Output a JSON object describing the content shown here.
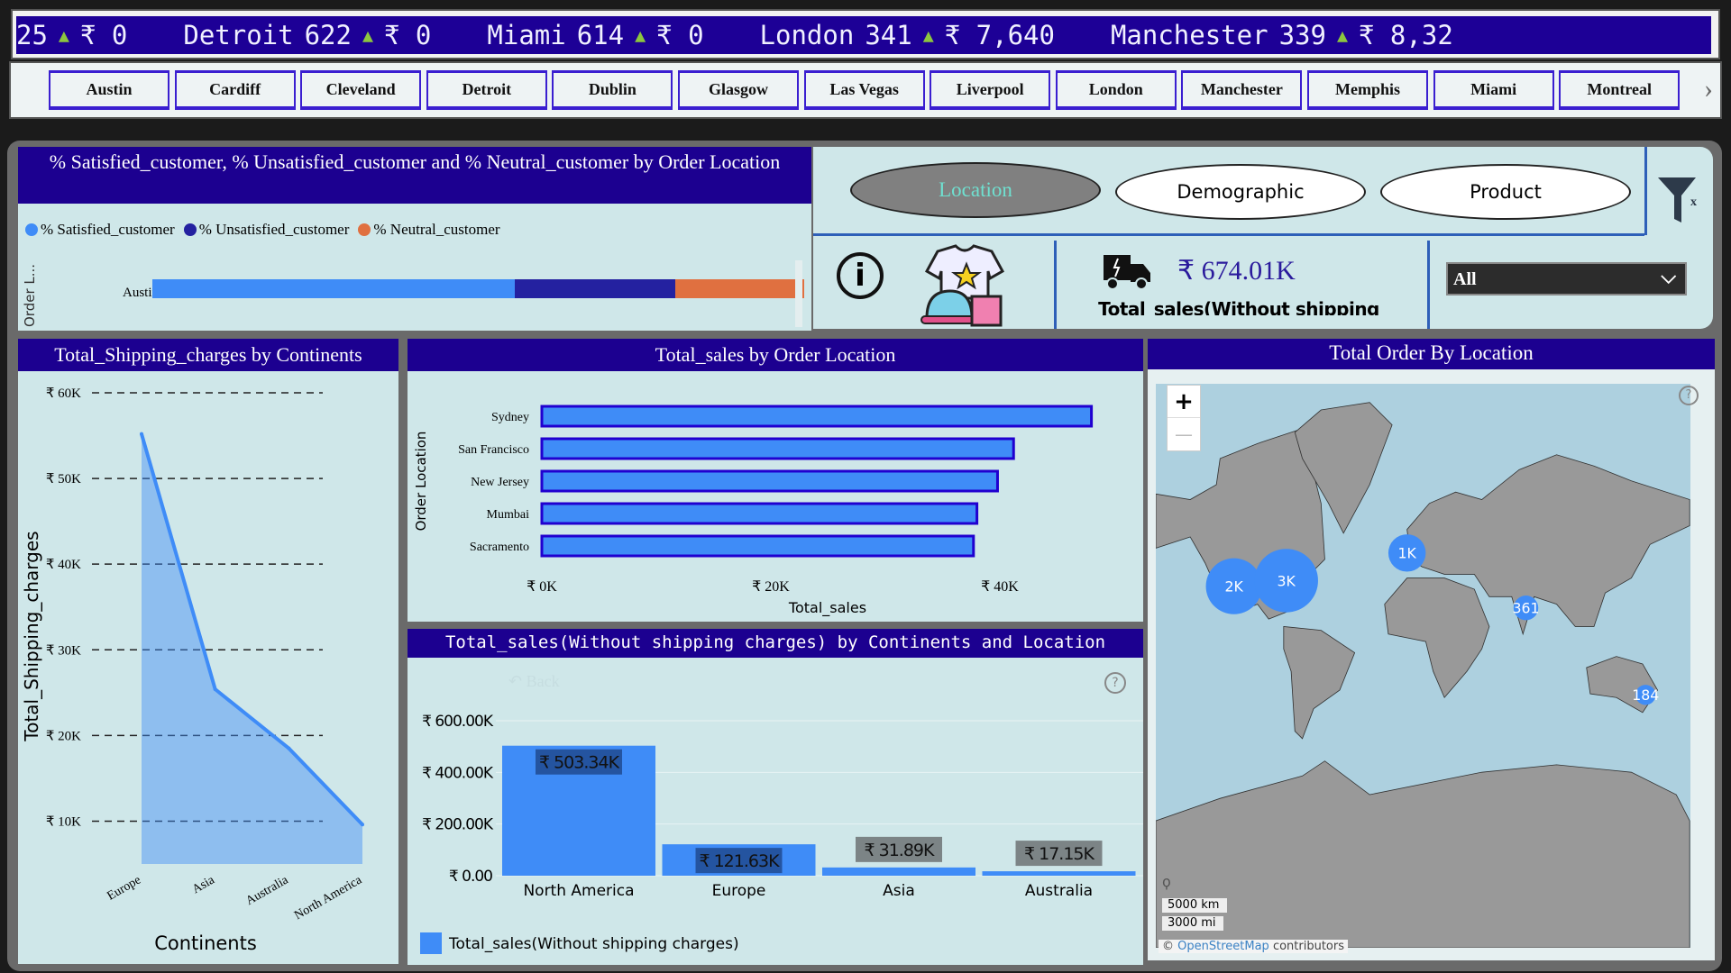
{
  "ticker": {
    "items": [
      {
        "city": "",
        "count": "25",
        "value": "₹ 0"
      },
      {
        "city": "Detroit",
        "count": "622",
        "value": "₹ 0"
      },
      {
        "city": "Miami",
        "count": "614",
        "value": "₹ 0"
      },
      {
        "city": "London",
        "count": "341",
        "value": "₹ 7,640"
      },
      {
        "city": "Manchester",
        "count": "339",
        "value": "₹ 8,32"
      }
    ],
    "up_color": "#8cc63f"
  },
  "city_slicer": {
    "items": [
      "Austin",
      "Cardiff",
      "Cleveland",
      "Detroit",
      "Dublin",
      "Glasgow",
      "Las Vegas",
      "Liverpool",
      "London",
      "Manchester",
      "Memphis",
      "Miami",
      "Montreal"
    ],
    "next_icon": "chevron-right-icon"
  },
  "satisfaction": {
    "title": "% Satisfied_customer, % Unsatisfied_customer and % Neutral_customer by Order Location",
    "axis_label": "Order L...",
    "chart_data": {
      "type": "bar",
      "stacked": true,
      "orientation": "horizontal",
      "categories": [
        "Austin"
      ],
      "series": [
        {
          "name": "% Satisfied_customer",
          "values": [
            55.6
          ],
          "color": "#3f8cf7"
        },
        {
          "name": "% Unsatisfied_customer",
          "values": [
            24.6
          ],
          "color": "#2421a0"
        },
        {
          "name": "% Neutral_customer",
          "values": [
            19.8
          ],
          "color": "#e07040"
        }
      ]
    }
  },
  "nav": {
    "tabs": [
      {
        "label": "Location",
        "active": true
      },
      {
        "label": "Demographic",
        "active": false
      },
      {
        "label": "Product",
        "active": false
      }
    ],
    "kpi_value": "₹ 674.01K",
    "kpi_label": "Total_sales(Without shipping charges)",
    "dropdown_value": "All"
  },
  "shipping": {
    "title": "Total_Shipping_charges by Continents",
    "chart_data": {
      "type": "area",
      "categories": [
        "Europe",
        "Asia",
        "Australia",
        "North America"
      ],
      "values": [
        55200,
        25400,
        18500,
        9600
      ],
      "xlabel": "Continents",
      "ylabel": "Total_Shipping_charges",
      "ylim": [
        5000,
        60000
      ],
      "ticks": [
        {
          "v": 60000,
          "label": "₹ 60K"
        },
        {
          "v": 50000,
          "label": "₹ 50K"
        },
        {
          "v": 40000,
          "label": "₹ 40K"
        },
        {
          "v": 30000,
          "label": "₹ 30K"
        },
        {
          "v": 20000,
          "label": "₹ 20K"
        },
        {
          "v": 10000,
          "label": "₹ 10K"
        }
      ],
      "grid": true,
      "color": "#3f8cf7"
    }
  },
  "sales_location": {
    "title": "Total_sales by Order Location",
    "chart_data": {
      "type": "bar",
      "orientation": "horizontal",
      "categories": [
        "Sydney",
        "San Francisco",
        "New Jersey",
        "Mumbai",
        "Sacramento"
      ],
      "values": [
        48000,
        41200,
        39800,
        38000,
        37700
      ],
      "xlabel": "Total_sales",
      "ylabel": "Order Location",
      "xlim": [
        0,
        50000
      ],
      "ticks": [
        {
          "v": 0,
          "label": "₹ 0K"
        },
        {
          "v": 20000,
          "label": "₹ 20K"
        },
        {
          "v": 40000,
          "label": "₹ 40K"
        }
      ]
    }
  },
  "sales_continent": {
    "title": "Total_sales(Without shipping charges) by Continents and Location",
    "back_label": "Back",
    "chart_data": {
      "type": "bar",
      "categories": [
        "North America",
        "Europe",
        "Asia",
        "Australia"
      ],
      "values": [
        503340,
        121630,
        31890,
        17150
      ],
      "labels": [
        "₹ 503.34K",
        "₹ 121.63K",
        "₹ 31.89K",
        "₹ 17.15K"
      ],
      "ylim": [
        0,
        600000
      ],
      "ticks": [
        {
          "v": 600000,
          "label": "₹ 600.00K"
        },
        {
          "v": 400000,
          "label": "₹ 400.00K"
        },
        {
          "v": 200000,
          "label": "₹ 200.00K"
        },
        {
          "v": 0,
          "label": "₹ 0.00"
        }
      ],
      "legend": "Total_sales(Without shipping charges)",
      "legend_position": "bottom-left",
      "color": "#3f8cf7"
    }
  },
  "map": {
    "title": "Total Order By Location",
    "zoom_in": "+",
    "zoom_out": "—",
    "scale_km": "5000 km",
    "scale_mi": "3000 mi",
    "attribution_prefix": "©",
    "attribution_link": "OpenStreetMap",
    "attribution_suffix": "contributors",
    "bubbles": [
      {
        "label": "2K",
        "region": "US West"
      },
      {
        "label": "3K",
        "region": "US East"
      },
      {
        "label": "1K",
        "region": "UK / Ireland"
      },
      {
        "label": "361",
        "region": "India"
      },
      {
        "label": "184",
        "region": "Australia"
      }
    ]
  }
}
